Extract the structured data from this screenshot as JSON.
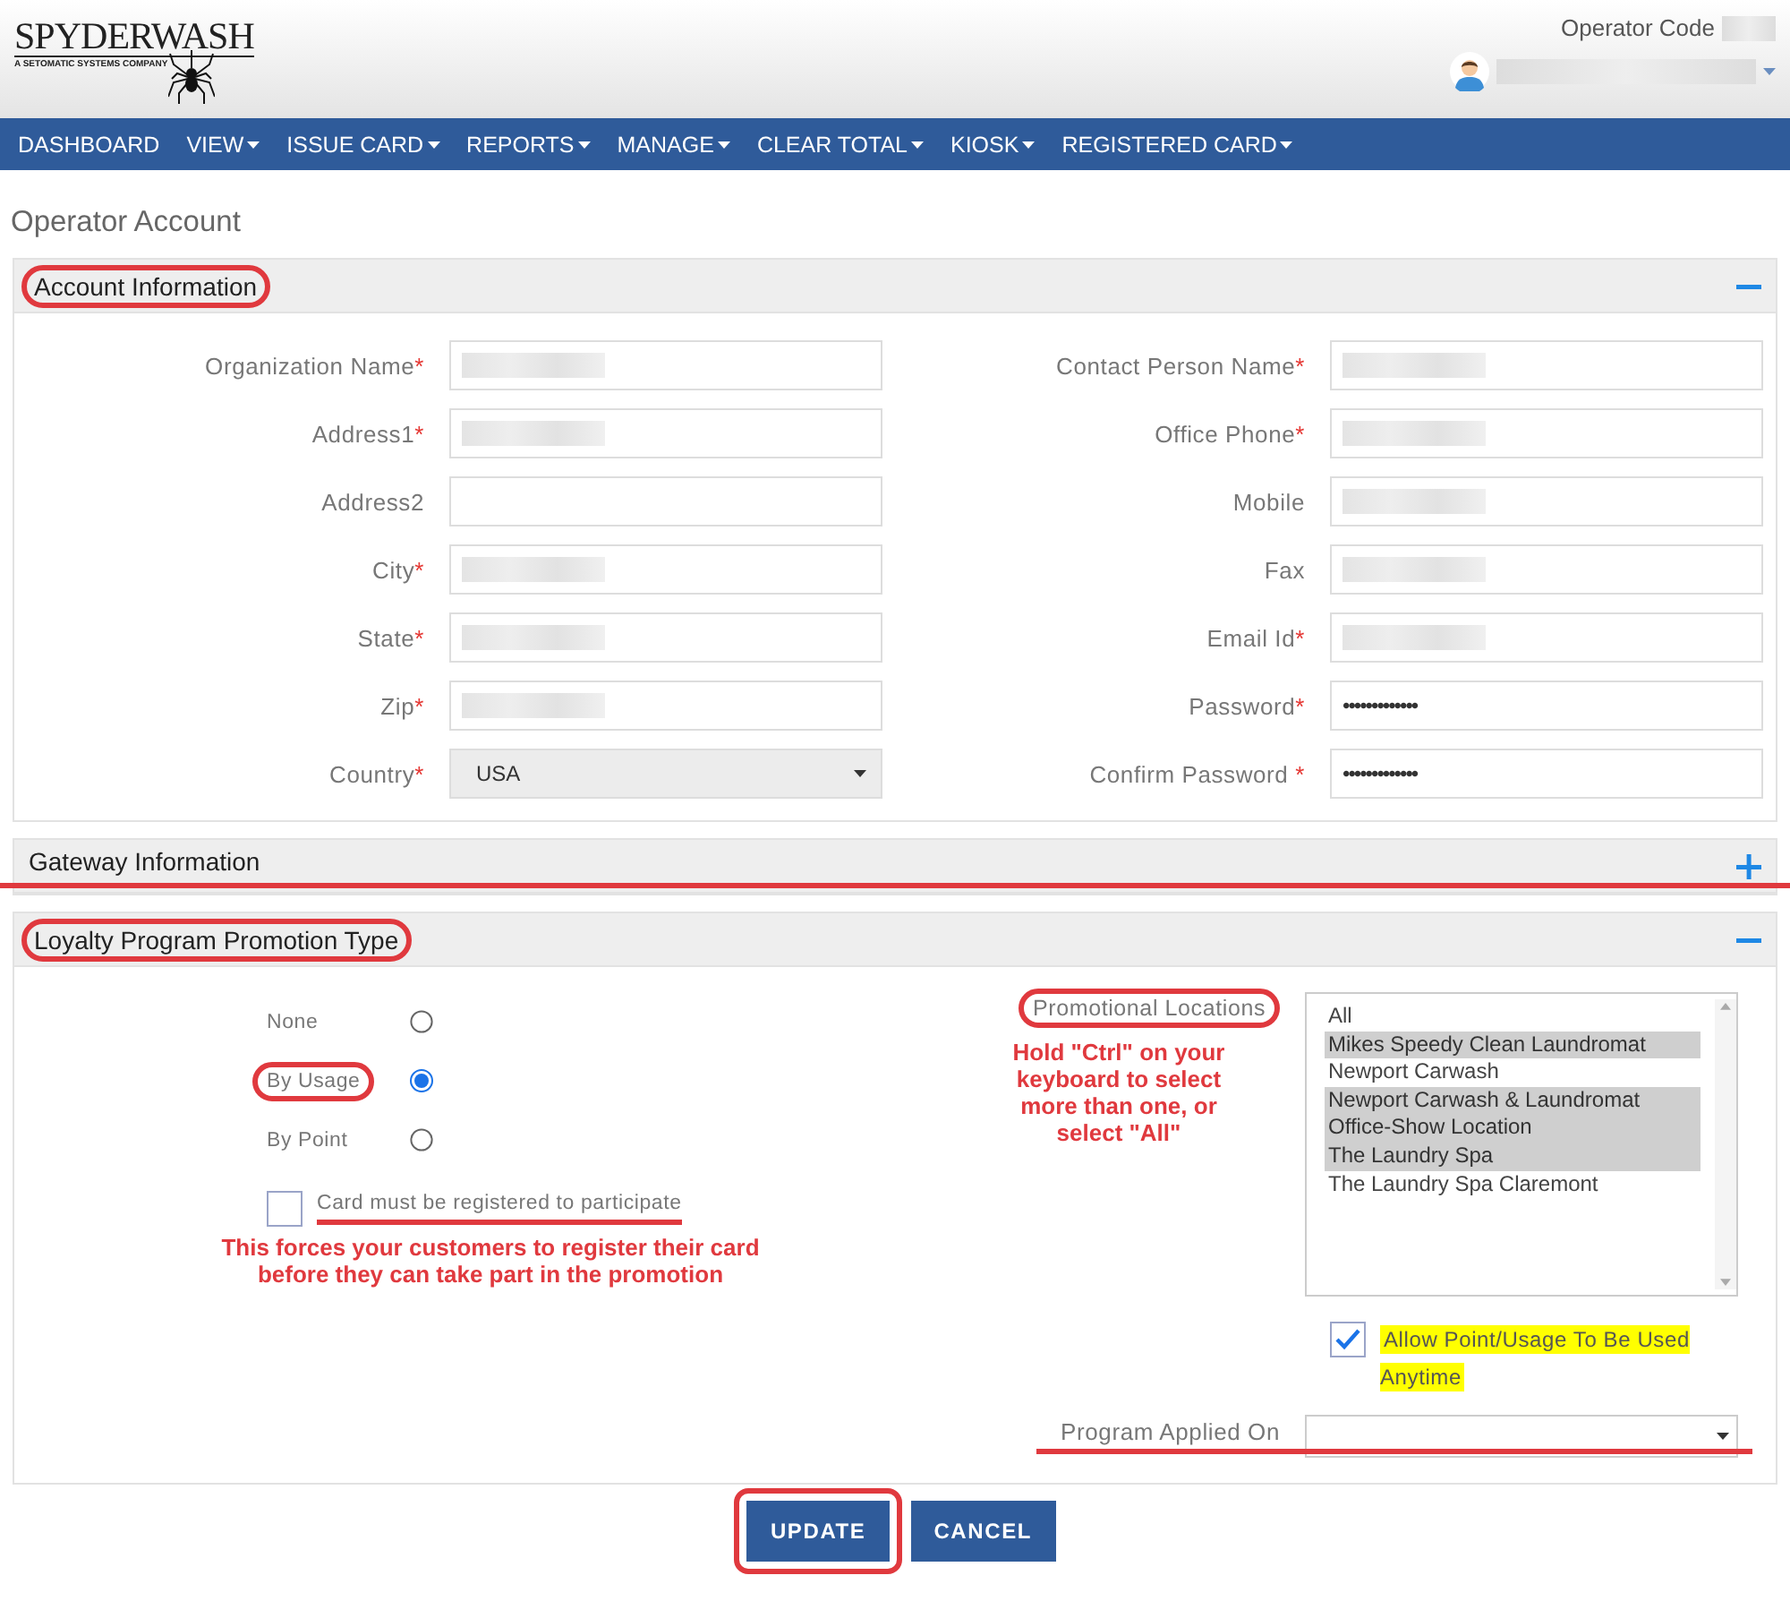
{
  "header": {
    "logo": {
      "wordmark": "SPYDERWASH",
      "tagline": "A SETOMATIC SYSTEMS COMPANY"
    },
    "operator_code_label": "Operator Code",
    "operator_code_redacted": true,
    "user_redacted": true
  },
  "nav": [
    {
      "label": "DASHBOARD",
      "dropdown": false
    },
    {
      "label": "VIEW",
      "dropdown": true
    },
    {
      "label": "ISSUE CARD",
      "dropdown": true
    },
    {
      "label": "REPORTS",
      "dropdown": true
    },
    {
      "label": "MANAGE",
      "dropdown": true
    },
    {
      "label": "CLEAR TOTAL",
      "dropdown": true
    },
    {
      "label": "KIOSK",
      "dropdown": true
    },
    {
      "label": "REGISTERED CARD",
      "dropdown": true
    }
  ],
  "page_title": "Operator Account",
  "account_section": {
    "title": "Account Information",
    "circled": true,
    "expanded": true,
    "fields_left": [
      {
        "label": "Organization Name",
        "required_mark": "*",
        "kind": "text",
        "redacted": true
      },
      {
        "label": "Address1",
        "required_mark": "*",
        "kind": "text",
        "redacted": true
      },
      {
        "label": "Address2",
        "kind": "text",
        "redacted": false
      },
      {
        "label": "City",
        "required_mark": "*",
        "kind": "text",
        "redacted": true
      },
      {
        "label": "State",
        "required_mark": "*",
        "kind": "text",
        "redacted": true
      },
      {
        "label": "Zip",
        "required_mark": "*",
        "kind": "text",
        "redacted": true
      },
      {
        "label": "Country",
        "required_mark": "*",
        "kind": "select",
        "value": "USA",
        "disabled": true
      }
    ],
    "fields_right": [
      {
        "label": "Contact Person Name",
        "required_mark": "*",
        "kind": "text",
        "redacted": true
      },
      {
        "label": "Office Phone",
        "required_mark": "*",
        "kind": "text",
        "redacted": true
      },
      {
        "label": "Mobile",
        "kind": "text",
        "redacted": true
      },
      {
        "label": "Fax",
        "kind": "text",
        "redacted": true
      },
      {
        "label": "Email Id",
        "required_mark": "*",
        "kind": "text",
        "redacted": true
      },
      {
        "label": "Password",
        "required_mark": "*",
        "kind": "password",
        "value": "•••••••••••••"
      },
      {
        "label": "Confirm Password ",
        "required_mark": "*",
        "kind": "password",
        "value": "•••••••••••••"
      }
    ]
  },
  "gateway_section": {
    "title": "Gateway Information",
    "expanded": false,
    "struck": true
  },
  "loyalty_section": {
    "title": "Loyalty Program Promotion Type",
    "circled": true,
    "expanded": true,
    "promotion_types": [
      {
        "label": "None",
        "selected": false,
        "circled": false
      },
      {
        "label": "By Usage",
        "selected": true,
        "circled": true
      },
      {
        "label": "By Point",
        "selected": false,
        "circled": false
      }
    ],
    "register_checkbox": {
      "label": "Card must be registered to participate",
      "checked": false,
      "underlined": true
    },
    "register_note": "This forces your customers to register their card before they can take part in the promotion",
    "locations": {
      "label": "Promotional Locations",
      "circled": true,
      "note": "Hold \"Ctrl\" on your keyboard to select more than one, or select \"All\"",
      "options": [
        {
          "label": "All",
          "selected": false
        },
        {
          "label": "Mikes Speedy Clean Laundromat",
          "selected": true
        },
        {
          "label": "Newport Carwash",
          "selected": false
        },
        {
          "label": "Newport Carwash & Laundromat",
          "selected": true
        },
        {
          "label": "Office-Show Location",
          "selected": true
        },
        {
          "label": "The Laundry Spa",
          "selected": true
        },
        {
          "label": "The Laundry Spa Claremont",
          "selected": false
        }
      ]
    },
    "allow_anytime": {
      "label": "Allow Point/Usage To Be Used Anytime",
      "checked": true,
      "highlighted": true
    },
    "program_applied_on": {
      "label": "Program Applied On",
      "struck": true
    }
  },
  "buttons": [
    {
      "label": "UPDATE",
      "circled": true
    },
    {
      "label": "CANCEL",
      "circled": false
    }
  ]
}
